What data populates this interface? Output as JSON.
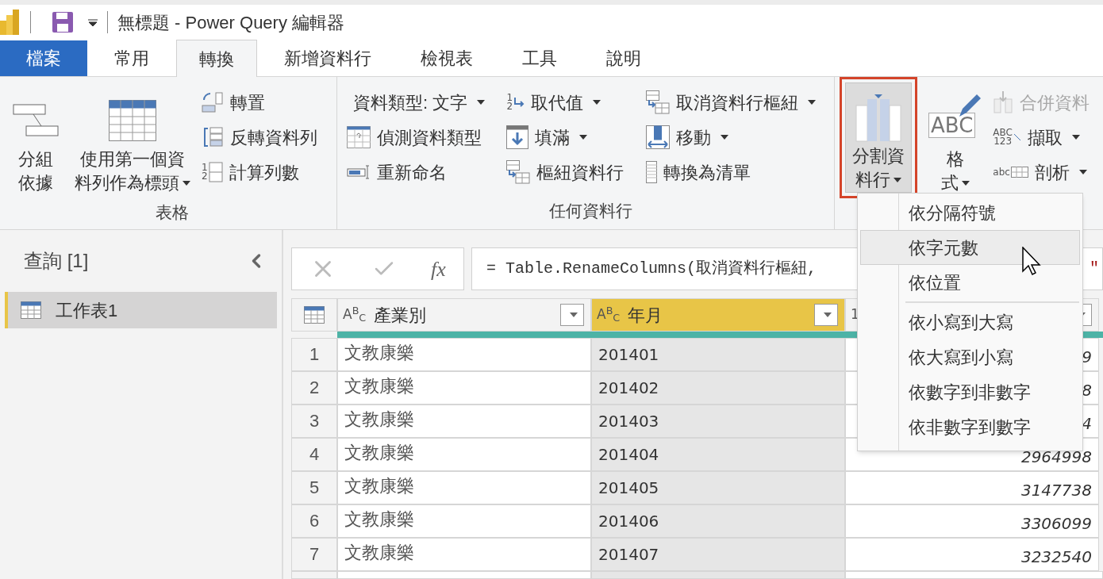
{
  "title_bar": {
    "title": "無標題 - Power Query 編輯器"
  },
  "tabs": [
    {
      "label": "檔案",
      "kind": "file",
      "selected": false
    },
    {
      "label": "常用",
      "kind": "tab",
      "selected": false
    },
    {
      "label": "轉換",
      "kind": "tab",
      "selected": true
    },
    {
      "label": "新增資料行",
      "kind": "tab",
      "selected": false
    },
    {
      "label": "檢視表",
      "kind": "tab",
      "selected": false
    },
    {
      "label": "工具",
      "kind": "tab",
      "selected": false
    },
    {
      "label": "說明",
      "kind": "tab",
      "selected": false
    }
  ],
  "ribbon": {
    "groups": [
      {
        "label": "表格",
        "large_buttons": [
          {
            "lines": [
              "分組",
              "依據"
            ],
            "dropdown": false,
            "highlighted": false
          },
          {
            "lines": [
              "使用第一個資",
              "料列作為標頭"
            ],
            "dropdown": true,
            "highlighted": false
          }
        ],
        "columns": [
          [
            {
              "label": "轉置",
              "dropdown": false,
              "disabled": false
            },
            {
              "label": "反轉資料列",
              "dropdown": false,
              "disabled": false
            },
            {
              "label": "計算列數",
              "glyph": [
                "1",
                "2"
              ],
              "dropdown": false,
              "disabled": false
            }
          ]
        ]
      },
      {
        "label": "任何資料行",
        "columns": [
          [
            {
              "label": "資料類型: 文字",
              "dropdown": true,
              "disabled": false
            },
            {
              "label": "偵測資料類型",
              "dropdown": false,
              "disabled": false
            },
            {
              "label": "重新命名",
              "dropdown": false,
              "disabled": false
            }
          ],
          [
            {
              "label": "取代值",
              "glyph": [
                "1",
                "2"
              ],
              "dropdown": true,
              "disabled": false
            },
            {
              "label": "填滿",
              "dropdown": true,
              "disabled": false
            },
            {
              "label": "樞紐資料行",
              "dropdown": false,
              "disabled": false
            }
          ],
          [
            {
              "label": "取消資料行樞紐",
              "dropdown": true,
              "disabled": false
            },
            {
              "label": "移動",
              "dropdown": true,
              "disabled": false
            },
            {
              "label": "轉換為清單",
              "dropdown": false,
              "disabled": false
            }
          ]
        ]
      },
      {
        "large_buttons": [
          {
            "lines": [
              "分割資",
              "料行"
            ],
            "dropdown": true,
            "highlighted": true
          },
          {
            "lines": [
              "格",
              "式"
            ],
            "dropdown": true,
            "glyph": [
              "ABC"
            ],
            "highlighted": false
          }
        ],
        "columns": [
          [
            {
              "label": "合併資料",
              "dropdown": false,
              "disabled": true
            },
            {
              "label": "擷取",
              "glyph": [
                "ABC",
                "123"
              ],
              "dropdown": true,
              "disabled": false
            },
            {
              "label": "剖析",
              "glyph": [
                "abc"
              ],
              "dropdown": true,
              "disabled": false
            }
          ]
        ]
      }
    ]
  },
  "query_pane": {
    "title": "查詢 [1]",
    "queries": [
      {
        "name": "工作表1",
        "selected": true
      }
    ]
  },
  "formula_bar": {
    "fx": "fx",
    "formula": "= Table.RenameColumns(取消資料行樞紐,",
    "formula_tail": "\""
  },
  "table": {
    "columns": [
      {
        "type": "A$^{B}$$_{C}$",
        "name": "產業別",
        "selected": false
      },
      {
        "type": "A$^{B}$$_{C}$",
        "name": "年月",
        "selected": true
      },
      {
        "type": "1",
        "selected": false
      }
    ],
    "rows": [
      {
        "number": "1",
        "cells": [
          "文教康樂",
          "201401",
          "9"
        ]
      },
      {
        "number": "2",
        "cells": [
          "文教康樂",
          "201402",
          "8"
        ]
      },
      {
        "number": "3",
        "cells": [
          "文教康樂",
          "201403",
          "4"
        ]
      },
      {
        "number": "4",
        "cells": [
          "文教康樂",
          "201404",
          "2964998"
        ]
      },
      {
        "number": "5",
        "cells": [
          "文教康樂",
          "201405",
          "3147738"
        ]
      },
      {
        "number": "6",
        "cells": [
          "文教康樂",
          "201406",
          "3306099"
        ]
      },
      {
        "number": "7",
        "cells": [
          "文教康樂",
          "201407",
          "3232540"
        ]
      }
    ]
  },
  "menu": {
    "items": [
      {
        "label": "依分隔符號",
        "selected": false,
        "separator_before": false
      },
      {
        "label": "依字元數",
        "selected": true,
        "separator_before": false
      },
      {
        "label": "依位置",
        "selected": false,
        "separator_before": false
      },
      {
        "label": "依小寫到大寫",
        "selected": false,
        "separator_before": true
      },
      {
        "label": "依大寫到小寫",
        "selected": false,
        "separator_before": false
      },
      {
        "label": "依數字到非數字",
        "selected": false,
        "separator_before": false
      },
      {
        "label": "依非數字到數字",
        "selected": false,
        "separator_before": false
      }
    ]
  }
}
